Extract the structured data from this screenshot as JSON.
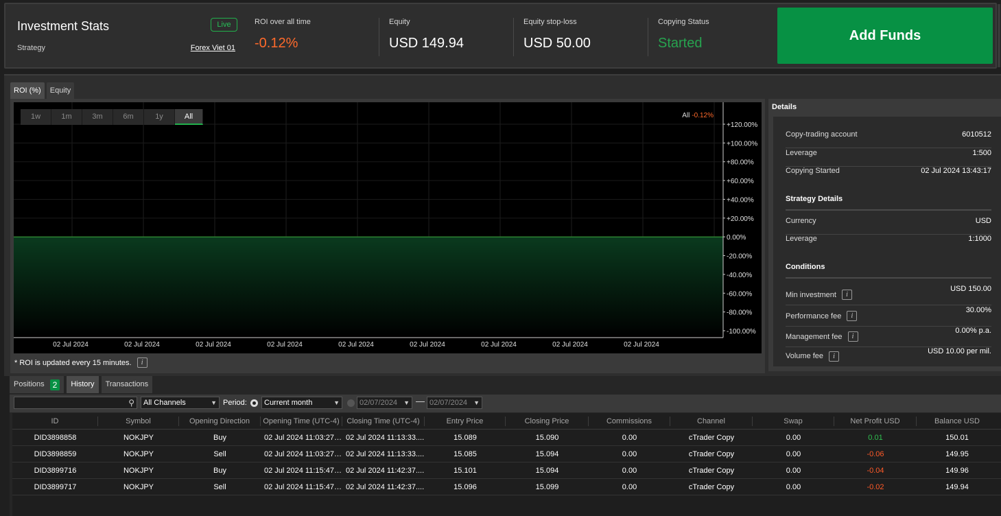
{
  "header": {
    "title": "Investment Stats",
    "strategy_label": "Strategy",
    "live_badge": "Live",
    "strategy_name": "Forex Viet 01",
    "stats": [
      {
        "label": "ROI over all time",
        "value": "-0.12%"
      },
      {
        "label": "Equity",
        "value": "USD 149.94"
      },
      {
        "label": "Equity stop-loss",
        "value": "USD 50.00"
      },
      {
        "label": "Copying Status",
        "value": "Started"
      }
    ],
    "add_funds": "Add Funds"
  },
  "chart_tabs": [
    "ROI (%)",
    "Equity"
  ],
  "range_buttons": [
    "1w",
    "1m",
    "3m",
    "6m",
    "1y",
    "All"
  ],
  "chart_legend": {
    "label": "All",
    "value": "-0.12%"
  },
  "roi_note": "* ROI is updated every 15 minutes.",
  "colors": {
    "accent": "#079144",
    "negative": "#ff6a2b",
    "positive": "#2fc04f",
    "line": "#3aa83a"
  },
  "chart_data": {
    "type": "area",
    "series": [
      {
        "values": [
          -0.12,
          -0.12,
          -0.12,
          -0.12,
          -0.12,
          -0.12,
          -0.12,
          -0.12,
          -0.12
        ]
      }
    ],
    "x_ticks": [
      "02 Jul 2024",
      "02 Jul 2024",
      "02 Jul 2024",
      "02 Jul 2024",
      "02 Jul 2024",
      "02 Jul 2024",
      "02 Jul 2024",
      "02 Jul 2024",
      "02 Jul 2024"
    ],
    "y_ticks": [
      "+120.00%",
      "+100.00%",
      "+80.00%",
      "+60.00%",
      "+40.00%",
      "+20.00%",
      "0.00%",
      "-20.00%",
      "-40.00%",
      "-60.00%",
      "-80.00%",
      "-100.00%"
    ],
    "ylim": [
      -100,
      120
    ],
    "grid": true
  },
  "details": {
    "title": "Details",
    "account": [
      {
        "k": "Copy-trading account",
        "v": "6010512"
      },
      {
        "k": "Leverage",
        "v": "1:500"
      },
      {
        "k": "Copying Started",
        "v": "02 Jul 2024 13:43:17"
      }
    ],
    "strategy_title": "Strategy Details",
    "strategy": [
      {
        "k": "Currency",
        "v": "USD"
      },
      {
        "k": "Leverage",
        "v": "1:1000"
      }
    ],
    "conditions_title": "Conditions",
    "conditions": [
      {
        "k": "Min investment",
        "v": "USD 150.00"
      },
      {
        "k": "Performance fee",
        "v": "30.00%"
      },
      {
        "k": "Management fee",
        "v": "0.00% p.a."
      },
      {
        "k": "Volume fee",
        "v": "USD 10.00 per mil."
      }
    ],
    "info_glyph": "i"
  },
  "bottom": {
    "tabs": [
      {
        "label": "Positions",
        "badge": "2"
      },
      {
        "label": "History"
      },
      {
        "label": "Transactions"
      }
    ],
    "channel_select": "All Channels",
    "period_label": "Period:",
    "period_select": "Current month",
    "date_from": "02/07/2024",
    "date_to": "02/07/2024",
    "columns": [
      "ID",
      "Symbol",
      "Opening Direction",
      "Opening Time (UTC-4)",
      "Closing Time (UTC-4)",
      "Entry Price",
      "Closing Price",
      "Commissions",
      "Channel",
      "Swap",
      "Net Profit USD",
      "Balance USD"
    ],
    "rows": [
      [
        "DID3898858",
        "NOKJPY",
        "Buy",
        "02 Jul 2024 11:03:27....",
        "02 Jul 2024 11:13:33....",
        "15.089",
        "15.090",
        "0.00",
        "cTrader Copy",
        "0.00",
        "0.01",
        "150.01"
      ],
      [
        "DID3898859",
        "NOKJPY",
        "Sell",
        "02 Jul 2024 11:03:27....",
        "02 Jul 2024 11:13:33....",
        "15.085",
        "15.094",
        "0.00",
        "cTrader Copy",
        "0.00",
        "-0.06",
        "149.95"
      ],
      [
        "DID3899716",
        "NOKJPY",
        "Buy",
        "02 Jul 2024 11:15:47....",
        "02 Jul 2024 11:42:37....",
        "15.101",
        "15.094",
        "0.00",
        "cTrader Copy",
        "0.00",
        "-0.04",
        "149.96"
      ],
      [
        "DID3899717",
        "NOKJPY",
        "Sell",
        "02 Jul 2024 11:15:47....",
        "02 Jul 2024 11:42:37....",
        "15.096",
        "15.099",
        "0.00",
        "cTrader Copy",
        "0.00",
        "-0.02",
        "149.94"
      ]
    ]
  }
}
